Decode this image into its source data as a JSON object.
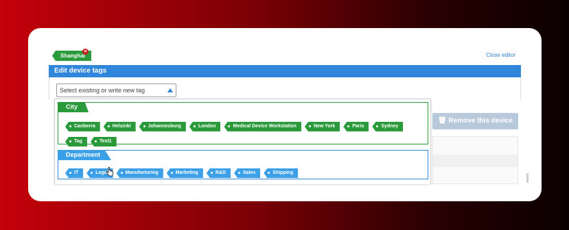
{
  "current_tag": {
    "label": "Shanghai",
    "remove_icon": "×"
  },
  "close_editor_label": "Close editor",
  "editor": {
    "header_title": "Edit device tags",
    "select_placeholder": "Select existing or write new tag"
  },
  "groups": {
    "city": {
      "title": "City",
      "tags": [
        "Canberra",
        "Helsinki",
        "Johannesburg",
        "London",
        "Medical Device Workstation",
        "New York",
        "Paris",
        "Sydney",
        "Tag",
        "Test1"
      ]
    },
    "department": {
      "title": "Department",
      "tags": [
        "IT",
        "Legal",
        "Manufacturing",
        "Marketing",
        "R&D",
        "Sales",
        "Shipping"
      ]
    }
  },
  "remove_device_label": "Remove this device",
  "colors": {
    "city_green": "#2a9a3a",
    "department_blue": "#3ba0e8",
    "header_blue": "#2f86db",
    "remove_red": "#c81f25"
  }
}
